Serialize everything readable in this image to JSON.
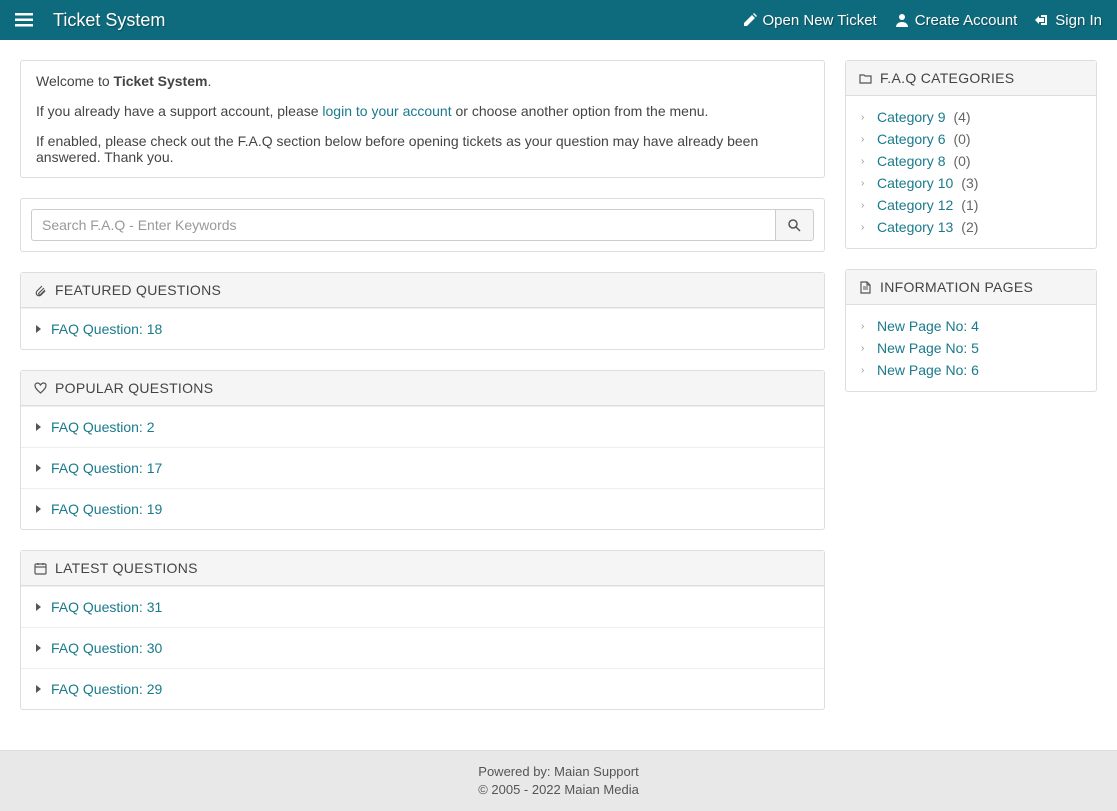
{
  "navbar": {
    "brand": "Ticket System",
    "open_ticket": "Open New Ticket",
    "create_account": "Create Account",
    "sign_in": "Sign In"
  },
  "welcome": {
    "prefix": "Welcome to ",
    "system_name": "Ticket System",
    "line2_pre": "If you already have a support account, please ",
    "login_link": "login to your account",
    "line2_post": " or choose another option from the menu.",
    "line3": "If enabled, please check out the F.A.Q section below before opening tickets as your question may have already been answered. Thank you."
  },
  "search": {
    "placeholder": "Search F.A.Q - Enter Keywords"
  },
  "sections": {
    "featured": {
      "title": "FEATURED QUESTIONS",
      "items": [
        "FAQ Question: 18"
      ]
    },
    "popular": {
      "title": "POPULAR QUESTIONS",
      "items": [
        "FAQ Question: 2",
        "FAQ Question: 17",
        "FAQ Question: 19"
      ]
    },
    "latest": {
      "title": "LATEST QUESTIONS",
      "items": [
        "FAQ Question: 31",
        "FAQ Question: 30",
        "FAQ Question: 29"
      ]
    }
  },
  "sidebar": {
    "categories": {
      "title": "F.A.Q CATEGORIES",
      "items": [
        {
          "name": "Category 9",
          "count": "(4)"
        },
        {
          "name": "Category 6",
          "count": "(0)"
        },
        {
          "name": "Category 8",
          "count": "(0)"
        },
        {
          "name": "Category 10",
          "count": "(3)"
        },
        {
          "name": "Category 12",
          "count": "(1)"
        },
        {
          "name": "Category 13",
          "count": "(2)"
        }
      ]
    },
    "pages": {
      "title": "INFORMATION PAGES",
      "items": [
        "New Page No: 4",
        "New Page No: 5",
        "New Page No: 6"
      ]
    }
  },
  "footer": {
    "line1": "Powered by: Maian Support",
    "line2": "© 2005 - 2022 Maian Media"
  }
}
